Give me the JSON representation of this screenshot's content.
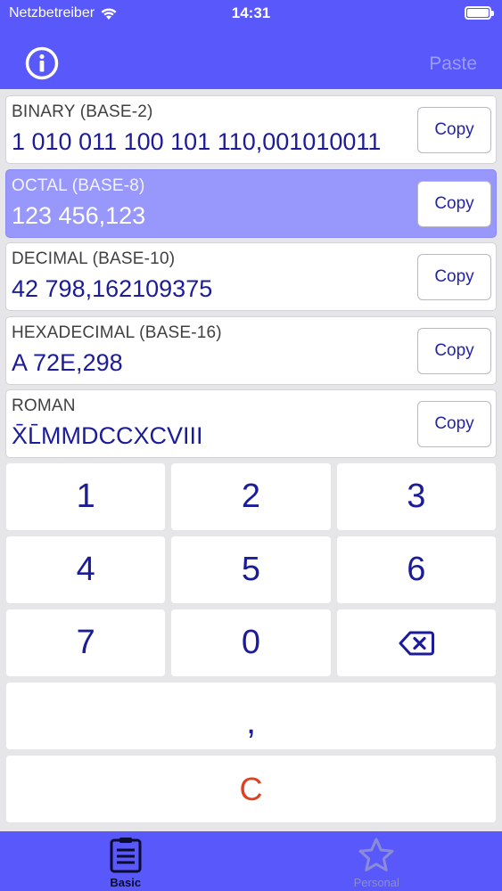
{
  "status": {
    "carrier": "Netzbetreiber",
    "time": "14:31"
  },
  "navbar": {
    "info_icon": "info-circle-icon",
    "paste_label": "Paste"
  },
  "rows": [
    {
      "label": "BINARY (BASE-2)",
      "value": "1 010 011 100 101 110,001010011",
      "copy_label": "Copy",
      "selected": false
    },
    {
      "label": "OCTAL (BASE-8)",
      "value": "123 456,123",
      "copy_label": "Copy",
      "selected": true
    },
    {
      "label": "DECIMAL (BASE-10)",
      "value": "42 798,162109375",
      "copy_label": "Copy",
      "selected": false
    },
    {
      "label": "HEXADECIMAL (BASE-16)",
      "value": "A 72E,298",
      "copy_label": "Copy",
      "selected": false
    },
    {
      "label": "ROMAN",
      "value": "X̄L̄MMDCCXCVIII",
      "copy_label": "Copy",
      "selected": false
    }
  ],
  "keypad": {
    "row1": [
      "1",
      "2",
      "3"
    ],
    "row2": [
      "4",
      "5",
      "6"
    ],
    "row3": [
      "7",
      "0"
    ],
    "backspace_icon": "backspace-icon",
    "comma": ",",
    "clear": "C"
  },
  "tabs": [
    {
      "label": "Basic",
      "icon": "list-clipboard-icon",
      "active": true
    },
    {
      "label": "Personal",
      "icon": "star-icon",
      "active": false
    }
  ],
  "colors": {
    "brand": "#5858fb",
    "selected_row": "#9898fc",
    "digit": "#1c1c99",
    "clear": "#e2401c"
  }
}
